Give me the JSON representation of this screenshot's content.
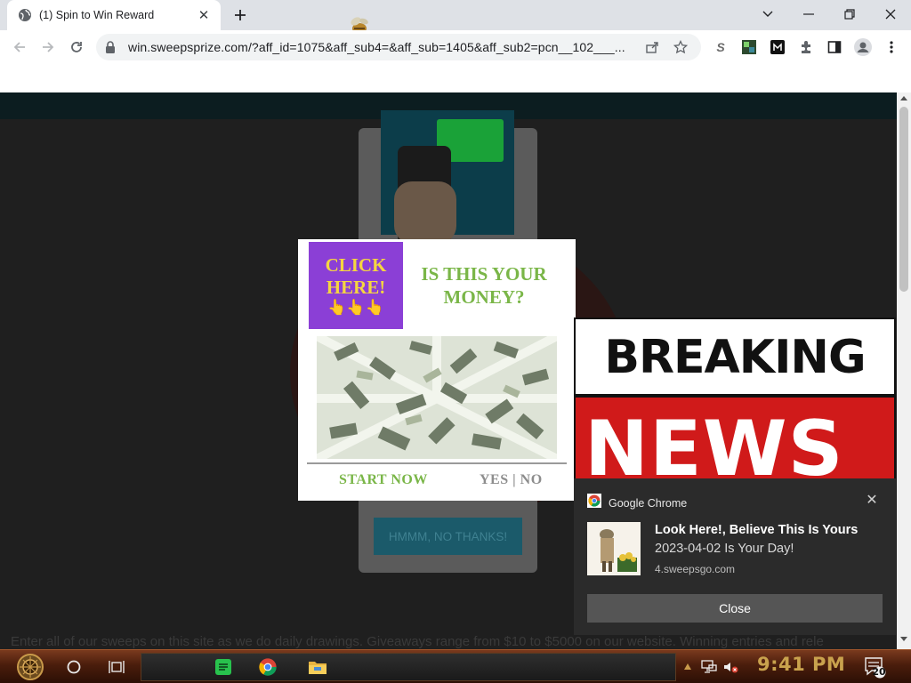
{
  "browser": {
    "tab_title": "(1) Spin to Win Reward",
    "url": "win.sweepsprize.com/?aff_id=1075&aff_sub4=&aff_sub=1405&aff_sub2=pcn__102___..."
  },
  "page": {
    "no_thanks_label": "HMMM, NO THANKS!",
    "bottom_text": "Enter all of our sweeps on this site as we do daily drawings. Giveaways range from $10 to $5000 on our website. Winning entries and rele"
  },
  "ad": {
    "click_here": "CLICK HERE!",
    "hands": "👆👆👆",
    "question": "IS THIS YOUR MONEY?",
    "start_now": "START NOW",
    "yes_no": "YES | NO"
  },
  "breaking_news": {
    "line1": "BREAKING",
    "line2": "NEWS"
  },
  "notification": {
    "app_name": "Google Chrome",
    "title": "Look Here!, Believe This Is Yours",
    "body": "2023-04-02 Is Your Day!",
    "source": "4.sweepsgo.com",
    "close_button": "Close"
  },
  "taskbar": {
    "clock": "9:41 PM",
    "notification_count": "20"
  },
  "colors": {
    "ad_purple": "#8b3fd6",
    "ad_green": "#7ab648",
    "news_red": "#d01a1a",
    "toast_bg": "#2b2b2b",
    "clock_gold": "#c9a24d"
  },
  "icons": [
    "globe-icon",
    "close-icon",
    "plus-icon",
    "chevron-down-icon",
    "minimize-icon",
    "maximize-icon",
    "back-icon",
    "forward-icon",
    "reload-icon",
    "lock-icon",
    "share-icon",
    "star-icon",
    "extension-icon",
    "sidepanel-icon",
    "profile-icon",
    "menu-icon",
    "chrome-icon",
    "folder-icon",
    "cortana-icon",
    "task-view-icon",
    "network-icon",
    "volume-muted-icon",
    "action-center-icon"
  ]
}
